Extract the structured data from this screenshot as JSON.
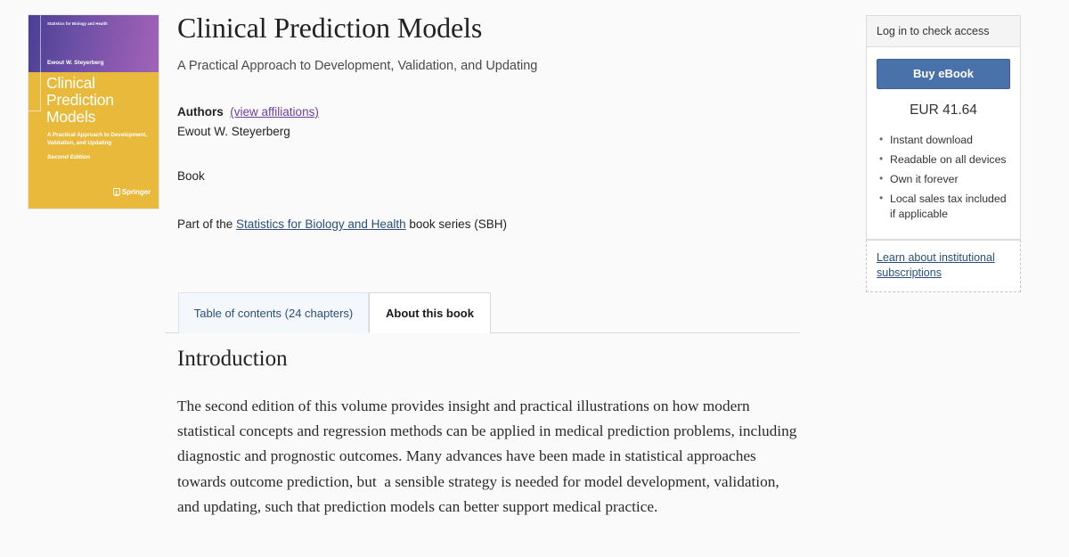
{
  "book_cover": {
    "series_label": "Statistics for Biology and Health",
    "author": "Ewout W. Steyerberg",
    "title": "Clinical\nPrediction\nModels",
    "subtitle": "A Practical Approach to Development, Validation, and Updating",
    "edition": "Second Edition",
    "publisher": "Springer",
    "colors": {
      "top_left": "#4b3f93",
      "top_right": "#a163b8",
      "body": "#e9b93c"
    }
  },
  "header": {
    "title": "Clinical Prediction Models",
    "subtitle": "A Practical Approach to Development, Validation, and Updating",
    "authors_label": "Authors",
    "view_affiliations": "(view affiliations)",
    "author_names": "Ewout W. Steyerberg",
    "content_type": "Book",
    "series_prefix": "Part of the ",
    "series_link": "Statistics for Biology and Health",
    "series_suffix": " book series (SBH)"
  },
  "access_panel": {
    "login_prompt": "Log in to check access",
    "buy_button": "Buy eBook",
    "price": "EUR 41.64",
    "perks": [
      "Instant download",
      "Readable on all devices",
      "Own it forever",
      "Local sales tax included if applicable"
    ],
    "institutional_link": "Learn about institutional subscriptions",
    "button_color": "#4a72aa"
  },
  "tabs": [
    {
      "label": "Table of contents (24 chapters)",
      "active": false
    },
    {
      "label": "About this book",
      "active": true
    }
  ],
  "main": {
    "section_title": "Introduction",
    "paragraph": "The second edition of this volume provides insight and practical illustrations on how modern statistical concepts and regression methods can be applied in medical prediction problems, including diagnostic and prognostic outcomes. Many advances have been made in statistical approaches towards outcome prediction, but  a sensible strategy is needed for model development, validation, and updating, such that prediction models can better support medical practice."
  }
}
